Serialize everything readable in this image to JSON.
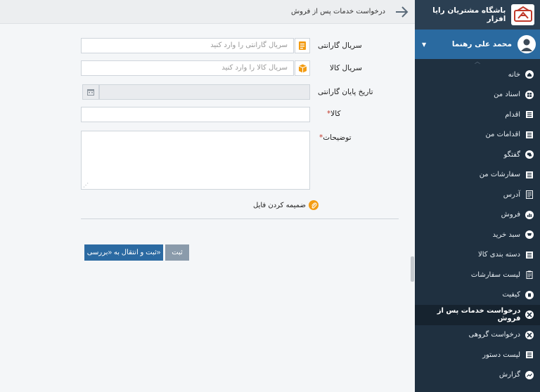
{
  "brand": {
    "title": "باشگاه مشتریان رایا افزار",
    "logo_icon": "raya-logo-icon"
  },
  "user": {
    "name": "محمد علی رهنما"
  },
  "menu": [
    {
      "label": "خانه",
      "icon": "home-icon"
    },
    {
      "label": "اسناد من",
      "icon": "documents-icon"
    },
    {
      "label": "اقدام",
      "icon": "list-icon"
    },
    {
      "label": "اقدامات من",
      "icon": "list-icon"
    },
    {
      "label": "گفتگو",
      "icon": "chat-icon"
    },
    {
      "label": "سفارشات من",
      "icon": "list-icon"
    },
    {
      "label": "آدرس",
      "icon": "address-icon"
    },
    {
      "label": "فروش",
      "icon": "sales-chart-icon"
    },
    {
      "label": "سبد خرید",
      "icon": "cart-icon"
    },
    {
      "label": "دسته بندی کالا",
      "icon": "list-icon"
    },
    {
      "label": "لیست سفارشات",
      "icon": "clipboard-icon"
    },
    {
      "label": "کیفیت",
      "icon": "quality-icon"
    },
    {
      "label": "درخواست خدمات پس از فروش",
      "icon": "tools-icon",
      "active": true
    },
    {
      "label": "درخواست گروهی",
      "icon": "tools-icon"
    },
    {
      "label": "لیست دستور",
      "icon": "list-icon"
    },
    {
      "label": "گزارش",
      "icon": "report-chart-icon"
    }
  ],
  "page": {
    "title": "درخواست خدمات پس از فروش"
  },
  "form": {
    "warranty_serial": {
      "label": "سریال گارانتی",
      "placeholder": "سریال گارانتی را وارد کنید"
    },
    "product_serial": {
      "label": "سریال کالا",
      "placeholder": "سریال کالا را وارد کنید"
    },
    "warranty_end": {
      "label": "تاریخ پایان گارانتی",
      "value": ""
    },
    "product": {
      "label": "کالا",
      "value": ""
    },
    "description": {
      "label": "توضیحات",
      "value": ""
    },
    "required_mark": "*",
    "attach_label": "ضمیمه کردن فایل",
    "submit_label": "ثبت",
    "submit_review_label": "«ثبت و انتقال به «بررسی"
  },
  "colors": {
    "sidebar_bg": "#1f3040",
    "user_bar": "#2a6aa0",
    "primary_button": "#2b6aa2",
    "attach_orange": "#f39c12"
  }
}
